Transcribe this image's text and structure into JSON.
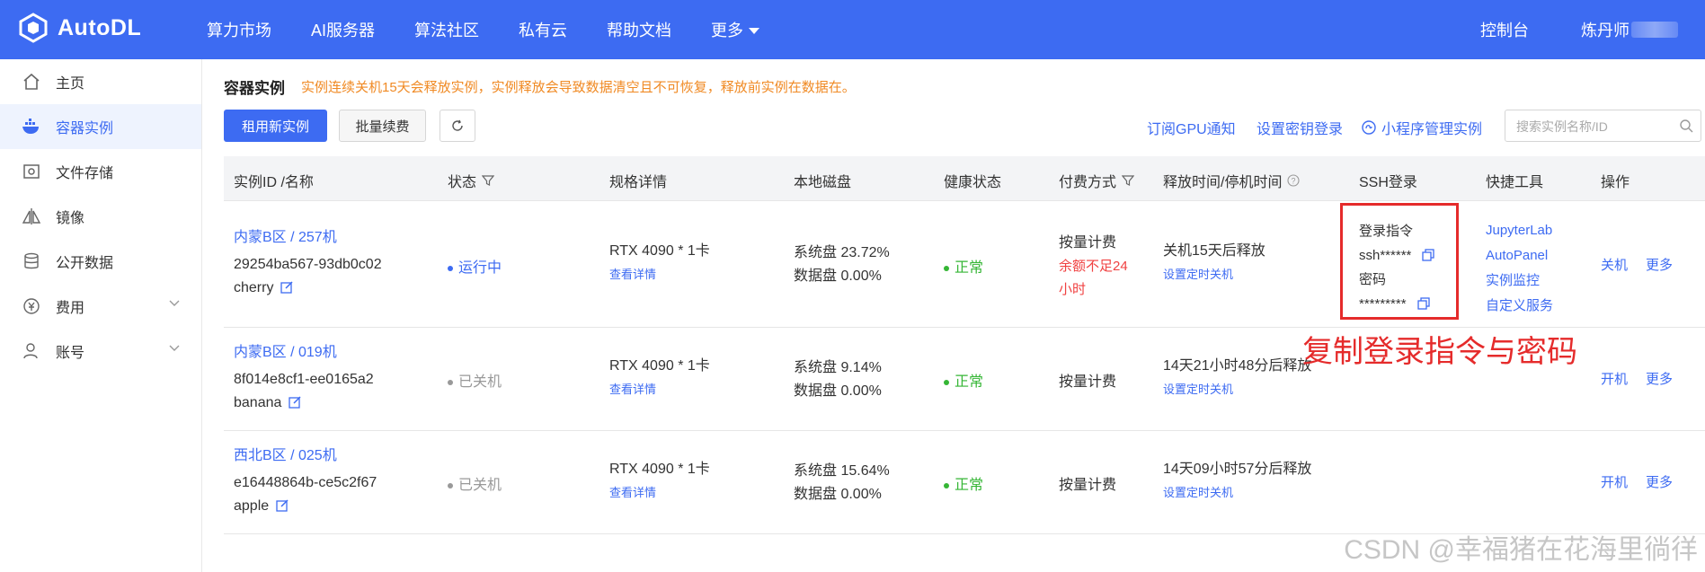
{
  "app": {
    "name": "AutoDL"
  },
  "nav": {
    "items": [
      "算力市场",
      "AI服务器",
      "算法社区",
      "私有云",
      "帮助文档",
      "更多"
    ],
    "console": "控制台",
    "user": "炼丹师"
  },
  "sidebar": {
    "items": [
      {
        "label": "主页",
        "icon": "home-icon"
      },
      {
        "label": "容器实例",
        "icon": "container-icon"
      },
      {
        "label": "文件存储",
        "icon": "storage-icon"
      },
      {
        "label": "镜像",
        "icon": "image-icon"
      },
      {
        "label": "公开数据",
        "icon": "database-icon"
      },
      {
        "label": "费用",
        "icon": "yen-icon"
      },
      {
        "label": "账号",
        "icon": "user-icon"
      }
    ]
  },
  "page": {
    "title": "容器实例",
    "warning": "实例连续关机15天会释放实例，实例释放会导致数据清空且不可恢复，释放前实例在数据在。"
  },
  "toolbar": {
    "new_instance": "租用新实例",
    "batch_renew": "批量续费",
    "subscribe_gpu": "订阅GPU通知",
    "set_key_login": "设置密钥登录",
    "mini_program": "小程序管理实例",
    "search_placeholder": "搜索实例名称/ID"
  },
  "table": {
    "headers": {
      "id": "实例ID /名称",
      "status": "状态",
      "spec": "规格详情",
      "disk": "本地磁盘",
      "health": "健康状态",
      "billing": "付费方式",
      "release": "释放时间/停机时间",
      "ssh": "SSH登录",
      "tools": "快捷工具",
      "ops": "操作"
    },
    "rows": [
      {
        "region": "内蒙B区 / 257机",
        "id": "29254ba567-93db0c02",
        "name": "cherry",
        "status": "运行中",
        "spec": "RTX 4090 * 1卡",
        "spec_link": "查看详情",
        "sys_disk": "系统盘 23.72%",
        "data_disk": "数据盘 0.00%",
        "health": "正常",
        "billing": "按量计费",
        "billing_warn_1": "余额不足24",
        "billing_warn_2": "小时",
        "release": "关机15天后释放",
        "release_link": "设置定时关机",
        "ssh_cmd_label": "登录指令",
        "ssh_cmd": "ssh******",
        "ssh_pwd_label": "密码",
        "ssh_pwd": "*********",
        "tools": [
          "JupyterLab",
          "AutoPanel",
          "实例监控",
          "自定义服务"
        ],
        "op_primary": "关机",
        "op_more": "更多"
      },
      {
        "region": "内蒙B区 / 019机",
        "id": "8f014e8cf1-ee0165a2",
        "name": "banana",
        "status": "已关机",
        "spec": "RTX 4090 * 1卡",
        "spec_link": "查看详情",
        "sys_disk": "系统盘 9.14%",
        "data_disk": "数据盘 0.00%",
        "health": "正常",
        "billing": "按量计费",
        "release": "14天21小时48分后释放",
        "release_link": "设置定时关机",
        "op_primary": "开机",
        "op_more": "更多"
      },
      {
        "region": "西北B区 / 025机",
        "id": "e16448864b-ce5c2f67",
        "name": "apple",
        "status": "已关机",
        "spec": "RTX 4090 * 1卡",
        "spec_link": "查看详情",
        "sys_disk": "系统盘 15.64%",
        "data_disk": "数据盘 0.00%",
        "health": "正常",
        "billing": "按量计费",
        "release": "14天09小时57分后释放",
        "release_link": "设置定时关机",
        "op_primary": "开机",
        "op_more": "更多"
      }
    ]
  },
  "annotation": "复制登录指令与密码",
  "watermark": "CSDN @幸福猪在花海里徜徉",
  "colors": {
    "brand": "#3d6bf2",
    "warning": "#f08a24",
    "ok": "#35b635",
    "alert": "#e52b2b"
  }
}
